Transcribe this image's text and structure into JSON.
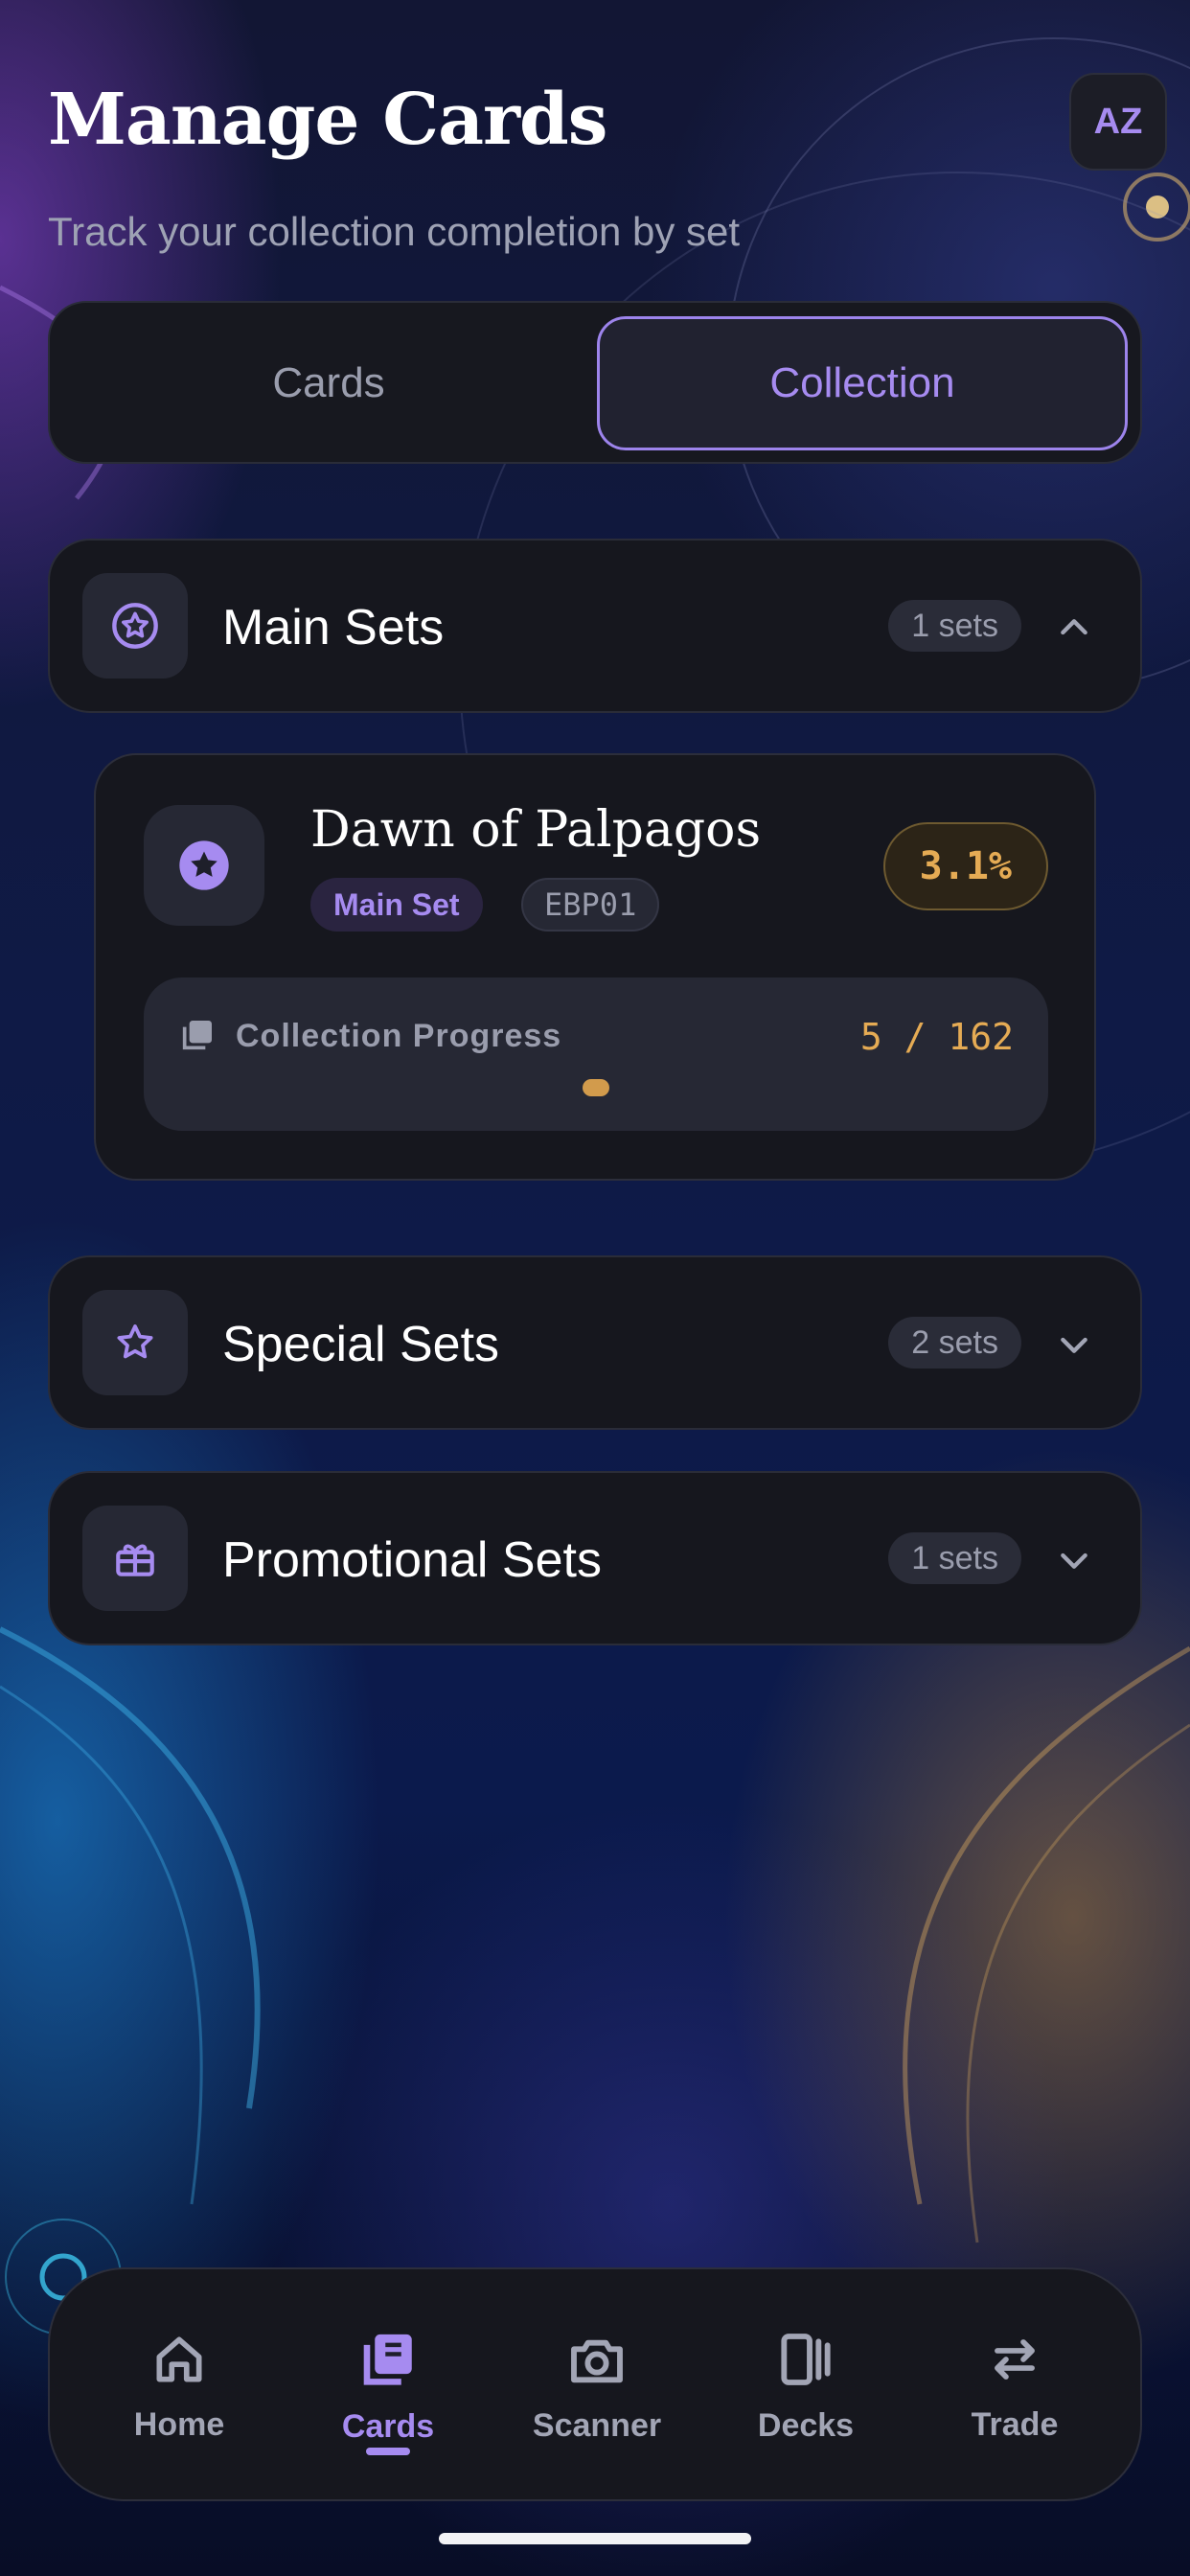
{
  "header": {
    "title": "Manage Cards",
    "subtitle": "Track your collection completion by set",
    "sort_icon": "sort-az-icon",
    "sort_label": "AZ"
  },
  "segments": {
    "left": "Cards",
    "right": "Collection",
    "active": "Collection"
  },
  "sections": [
    {
      "title": "Main Sets",
      "count": "1 sets",
      "icon": "star-circle-icon",
      "expanded": true
    },
    {
      "title": "Special Sets",
      "count": "2 sets",
      "icon": "star-icon",
      "expanded": false
    },
    {
      "title": "Promotional Sets",
      "count": "1 sets",
      "icon": "gift-icon",
      "expanded": false
    }
  ],
  "set_card": {
    "name": "Dawn of Palpagos",
    "type_tag": "Main Set",
    "code": "EBP01",
    "percent": "3.1%",
    "progress_label": "Collection Progress",
    "progress_count": "5 / 162",
    "progress_fraction": 0.031
  },
  "tabbar": {
    "items": [
      {
        "label": "Home",
        "icon": "home-icon"
      },
      {
        "label": "Cards",
        "icon": "cards-icon",
        "active": true
      },
      {
        "label": "Scanner",
        "icon": "camera-icon"
      },
      {
        "label": "Decks",
        "icon": "decks-icon"
      },
      {
        "label": "Trade",
        "icon": "trade-arrows-icon"
      }
    ]
  },
  "colors": {
    "accent": "#a68bf0",
    "gold": "#e5ab54",
    "card_bg": "#16171e"
  }
}
